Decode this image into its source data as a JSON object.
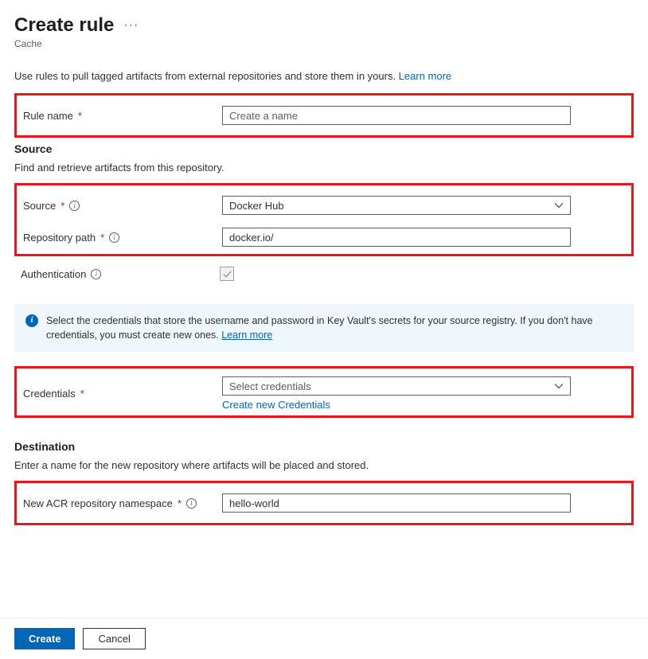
{
  "header": {
    "title": "Create rule",
    "subtitle": "Cache"
  },
  "intro": {
    "text": "Use rules to pull tagged artifacts from external repositories and store them in yours. ",
    "link": "Learn more"
  },
  "ruleName": {
    "label": "Rule name",
    "placeholder": "Create a name",
    "value": ""
  },
  "source": {
    "heading": "Source",
    "description": "Find and retrieve artifacts from this repository.",
    "sourceLabel": "Source",
    "sourceValue": "Docker Hub",
    "repoPathLabel": "Repository path",
    "repoPathValue": "docker.io/",
    "authLabel": "Authentication",
    "authChecked": true
  },
  "banner": {
    "text": "Select the credentials that store the username and password in Key Vault's secrets for your source registry. If you don't have credentials, you must create new ones. ",
    "link": "Learn more"
  },
  "credentials": {
    "label": "Credentials",
    "placeholder": "Select credentials",
    "createLink": "Create new Credentials"
  },
  "destination": {
    "heading": "Destination",
    "description": "Enter a name for the new repository where artifacts will be placed and stored.",
    "namespaceLabel": "New ACR repository namespace",
    "namespaceValue": "hello-world"
  },
  "footer": {
    "create": "Create",
    "cancel": "Cancel"
  }
}
